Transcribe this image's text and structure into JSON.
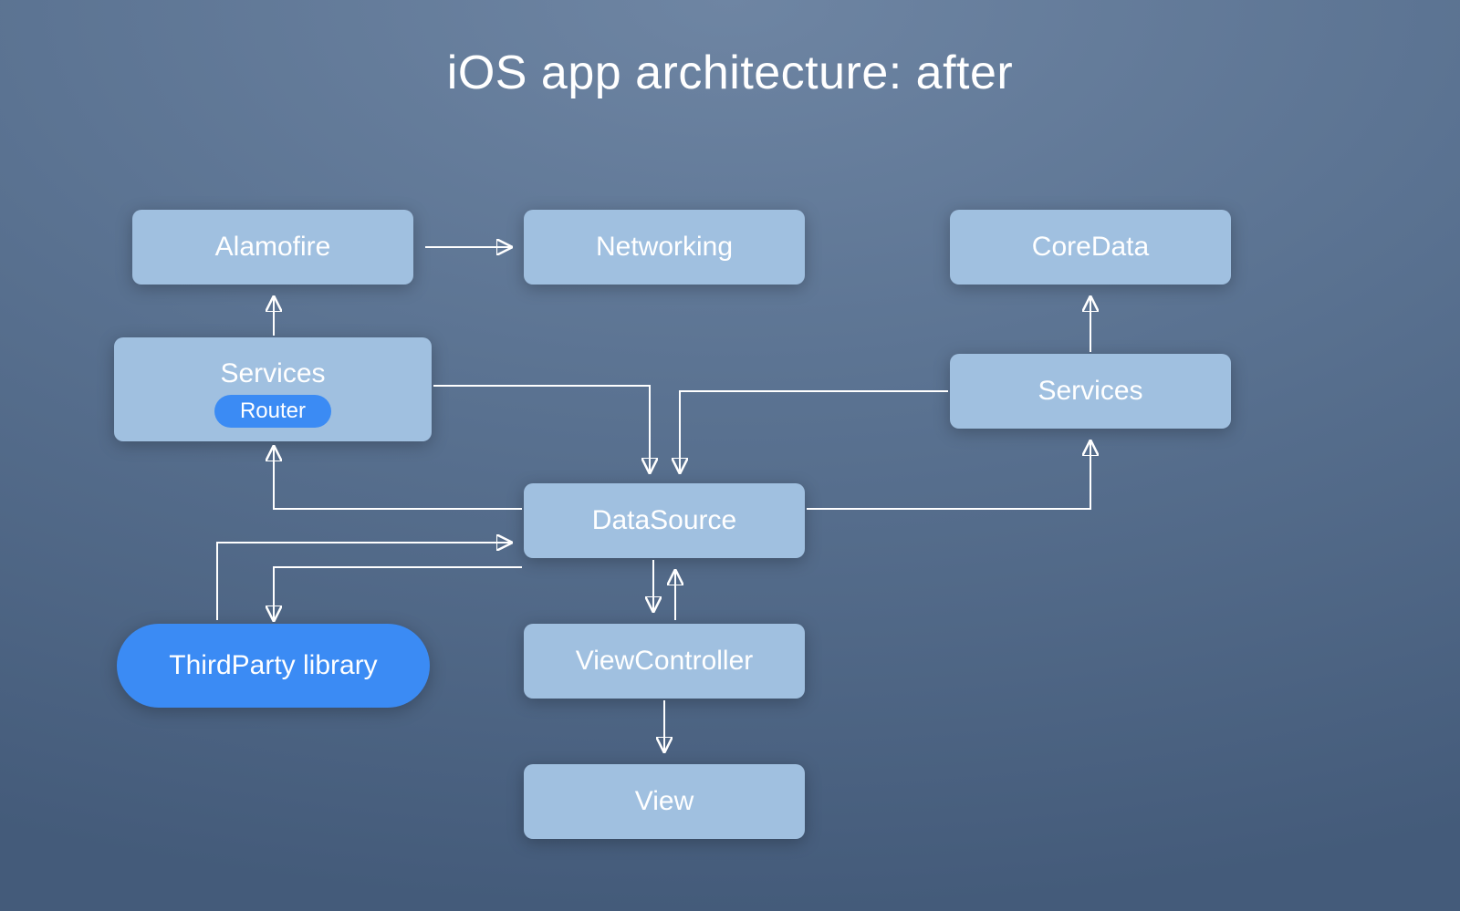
{
  "title": "iOS app architecture: after",
  "nodes": {
    "alamofire": "Alamofire",
    "networking": "Networking",
    "coredata": "CoreData",
    "services_left_label": "Services",
    "services_left_sub": "Router",
    "services_right": "Services",
    "datasource": "DataSource",
    "thirdparty": "ThirdParty library",
    "viewcontroller": "ViewController",
    "view": "View"
  }
}
